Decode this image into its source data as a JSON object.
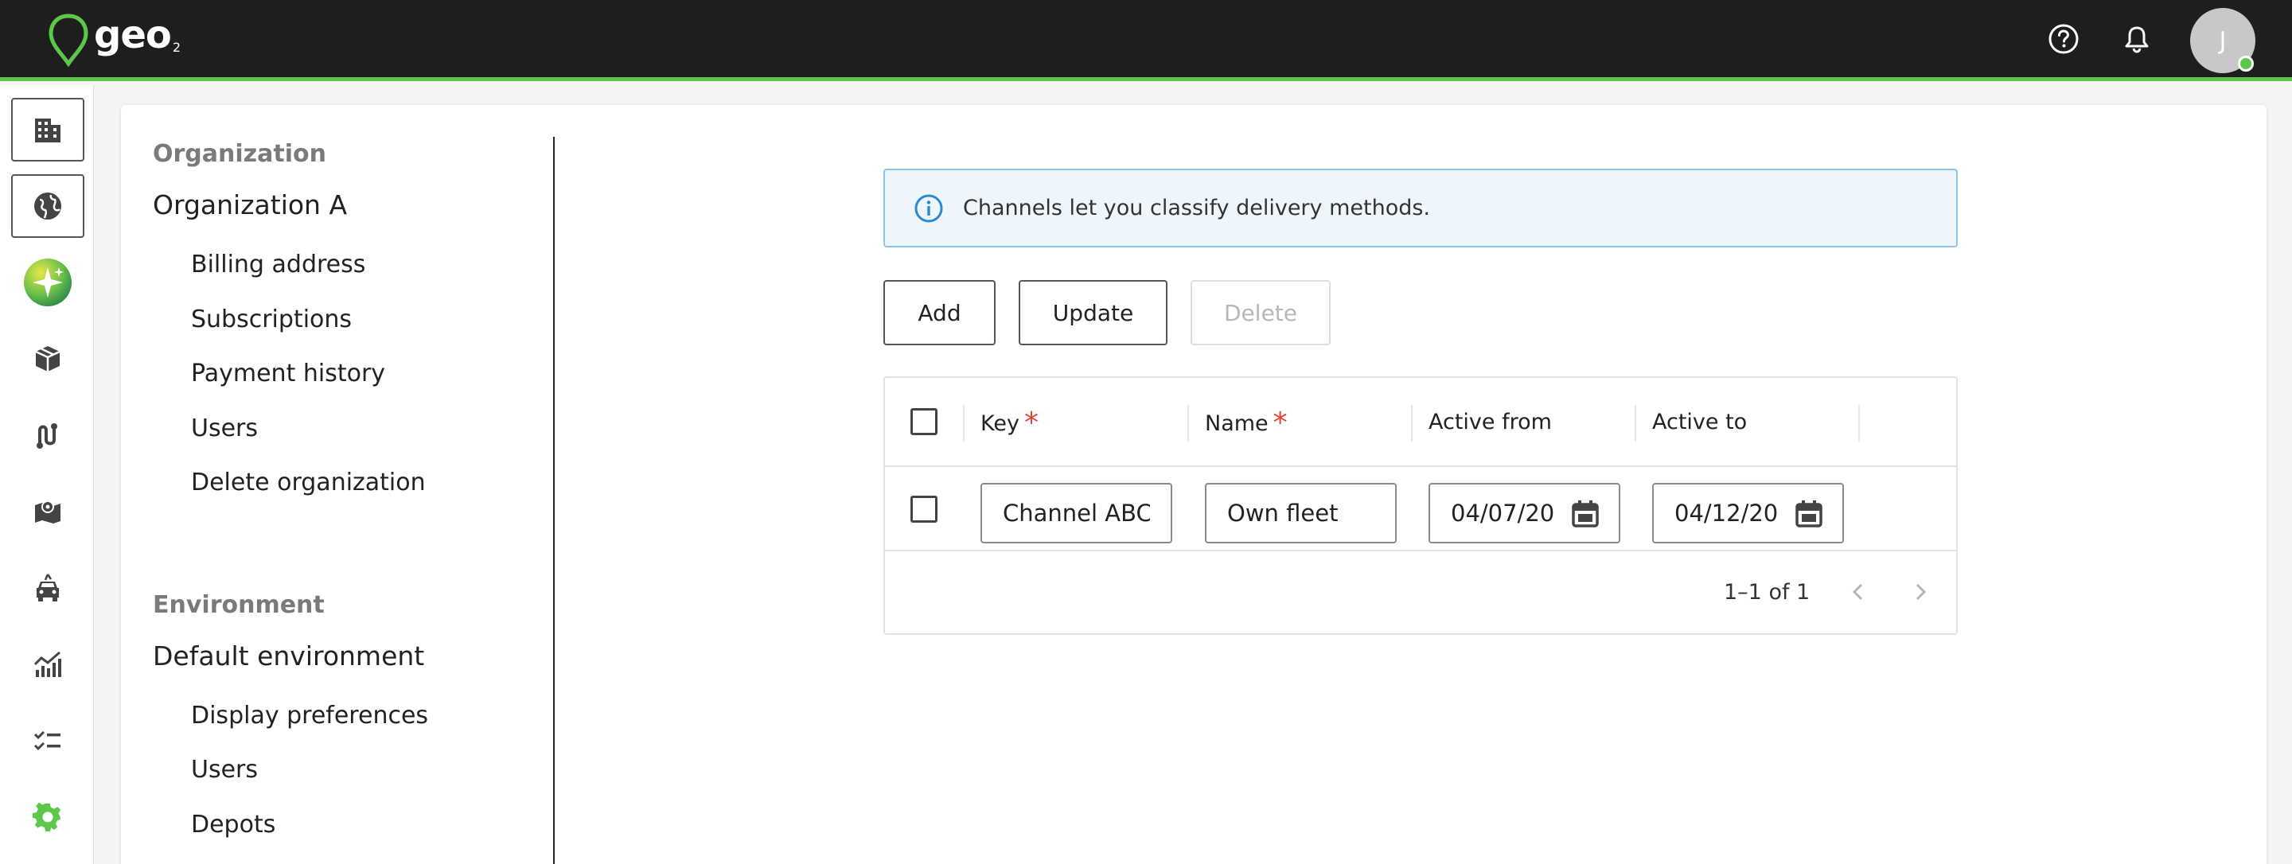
{
  "app": {
    "logo_text": "geo",
    "logo_sub": "2"
  },
  "header": {
    "icons": [
      "help-icon",
      "bell-icon"
    ],
    "avatar_initial": "J",
    "status": "online"
  },
  "rail": {
    "items": [
      "building-icon",
      "globe-icon",
      "sparkle-icon",
      "package-icon",
      "route-icon",
      "map-icon",
      "vehicle-icon",
      "analytics-icon",
      "checklist-icon",
      "settings-icon"
    ],
    "active": "settings-icon"
  },
  "settings_nav": {
    "organization_title": "Organization",
    "organization_name": "Organization A",
    "organization_links": [
      "Billing address",
      "Subscriptions",
      "Payment history",
      "Users",
      "Delete organization"
    ],
    "environment_title": "Environment",
    "environment_name": "Default environment",
    "environment_links": [
      "Display preferences",
      "Users",
      "Depots"
    ]
  },
  "info_banner": {
    "text": "Channels let you classify delivery methods."
  },
  "toolbar": {
    "add_label": "Add",
    "update_label": "Update",
    "delete_label": "Delete",
    "delete_disabled": true
  },
  "table": {
    "columns": [
      {
        "label": "Key",
        "required": true
      },
      {
        "label": "Name",
        "required": true
      },
      {
        "label": "Active from",
        "required": false
      },
      {
        "label": "Active to",
        "required": false
      }
    ],
    "rows": [
      {
        "key": "Channel ABC",
        "name": "Own fleet",
        "active_from": "04/07/20",
        "active_to": "04/12/20",
        "checked": false
      }
    ],
    "pagination": {
      "text": "1–1 of 1"
    }
  },
  "colors": {
    "accent": "#5cc84a",
    "topbar": "#1e1e1e",
    "required": "#e0462f",
    "info_border": "#8cc4ea",
    "info_bg": "#eef6fc"
  }
}
